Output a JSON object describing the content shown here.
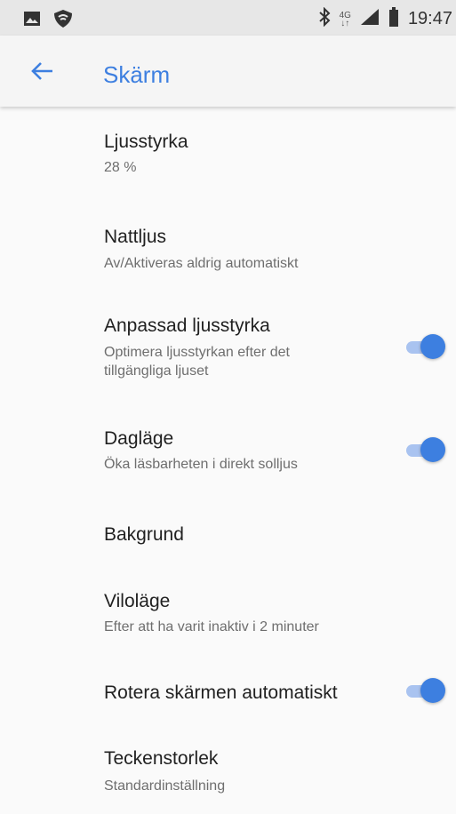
{
  "status_bar": {
    "time": "19:47",
    "network_type": "4G",
    "icons": [
      "image-icon",
      "shield-icon",
      "bluetooth-icon",
      "signal-icon",
      "battery-icon"
    ]
  },
  "app_bar": {
    "title": "Skärm",
    "back_icon": "arrow-back-icon",
    "accent_color": "#3d7fe0"
  },
  "settings": [
    {
      "title": "Ljusstyrka",
      "subtitle": "28 %"
    },
    {
      "title": "Nattljus",
      "subtitle": "Av/Aktiveras aldrig automatiskt"
    },
    {
      "title": "Anpassad ljusstyrka",
      "subtitle_line1": "Optimera ljusstyrkan efter det",
      "subtitle_line2": "tillgängliga ljuset",
      "toggle_on": true
    },
    {
      "title": "Dagläge",
      "subtitle": "Öka läsbarheten i direkt solljus",
      "toggle_on": true
    },
    {
      "title": "Bakgrund"
    },
    {
      "title": "Viloläge",
      "subtitle": "Efter att ha varit inaktiv i 2 minuter"
    },
    {
      "title": "Rotera skärmen automatiskt",
      "toggle_on": true
    },
    {
      "title": "Teckenstorlek",
      "subtitle": "Standardinställning"
    }
  ]
}
